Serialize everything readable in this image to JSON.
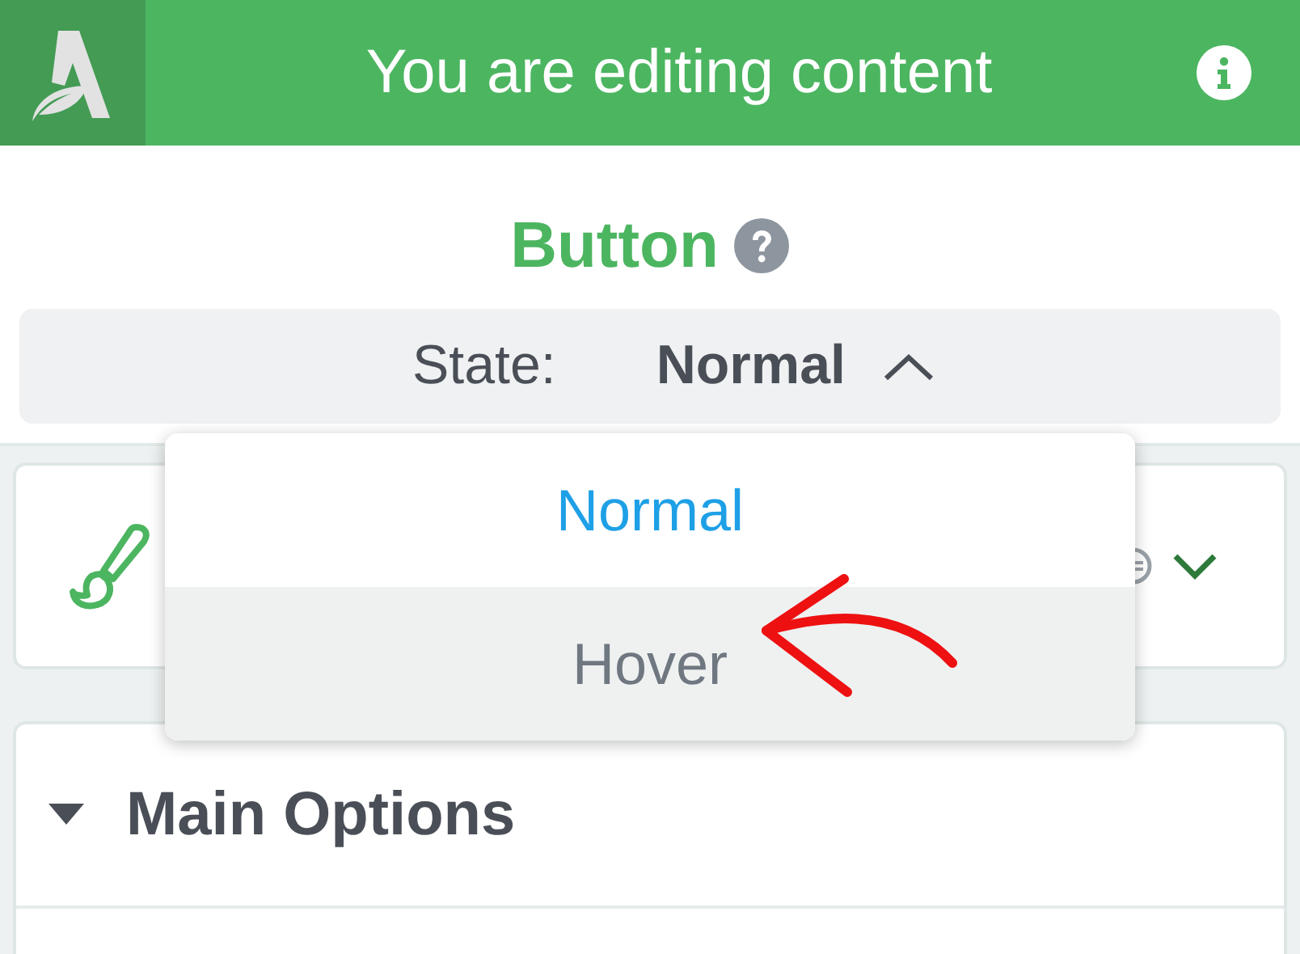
{
  "header": {
    "title": "You are editing content"
  },
  "element": {
    "title": "Button"
  },
  "state_selector": {
    "label": "State:",
    "value": "Normal",
    "expanded": true
  },
  "dropdown": {
    "options": [
      {
        "label": "Normal",
        "selected": true,
        "hovered": false
      },
      {
        "label": "Hover",
        "selected": false,
        "hovered": true
      }
    ]
  },
  "sections": [
    {
      "title": "Main Options",
      "expanded": true
    }
  ]
}
